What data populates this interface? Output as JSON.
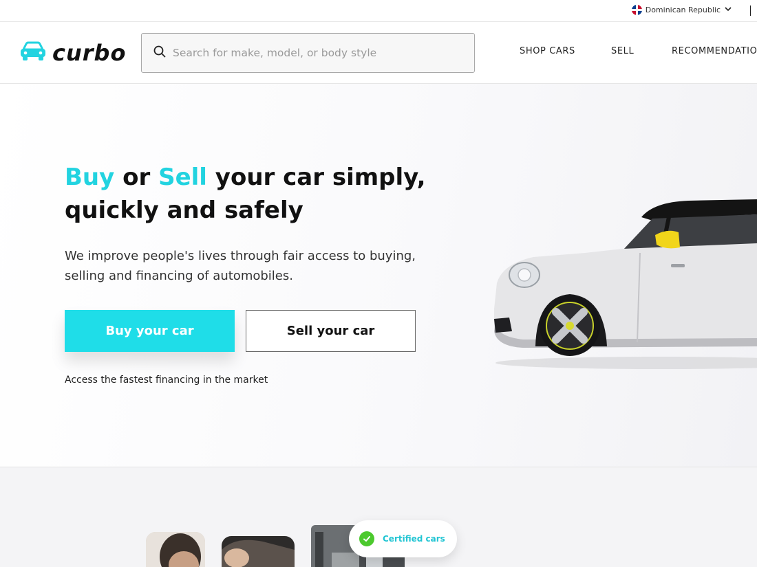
{
  "topbar": {
    "country": "Dominican Republic"
  },
  "header": {
    "logo_text": "curbo",
    "search_placeholder": "Search for make, model, or body style",
    "nav": [
      {
        "label": "SHOP CARS"
      },
      {
        "label": "SELL"
      },
      {
        "label": "RECOMMENDATIONS"
      }
    ]
  },
  "hero": {
    "headline_buy": "Buy",
    "headline_or": " or ",
    "headline_sell": "Sell",
    "headline_rest": " your car simply, quickly and safely",
    "subtext": "We improve people's lives through fair access to buying, selling and financing of automobiles.",
    "buy_button": "Buy your car",
    "sell_button": "Sell your car",
    "financing_text": "Access the fastest financing in the market"
  },
  "features": {
    "certified_label": "Certified cars"
  },
  "colors": {
    "accent": "#22d3e0",
    "buy_button_bg": "#1fdde8",
    "check_green": "#4cc92e"
  }
}
